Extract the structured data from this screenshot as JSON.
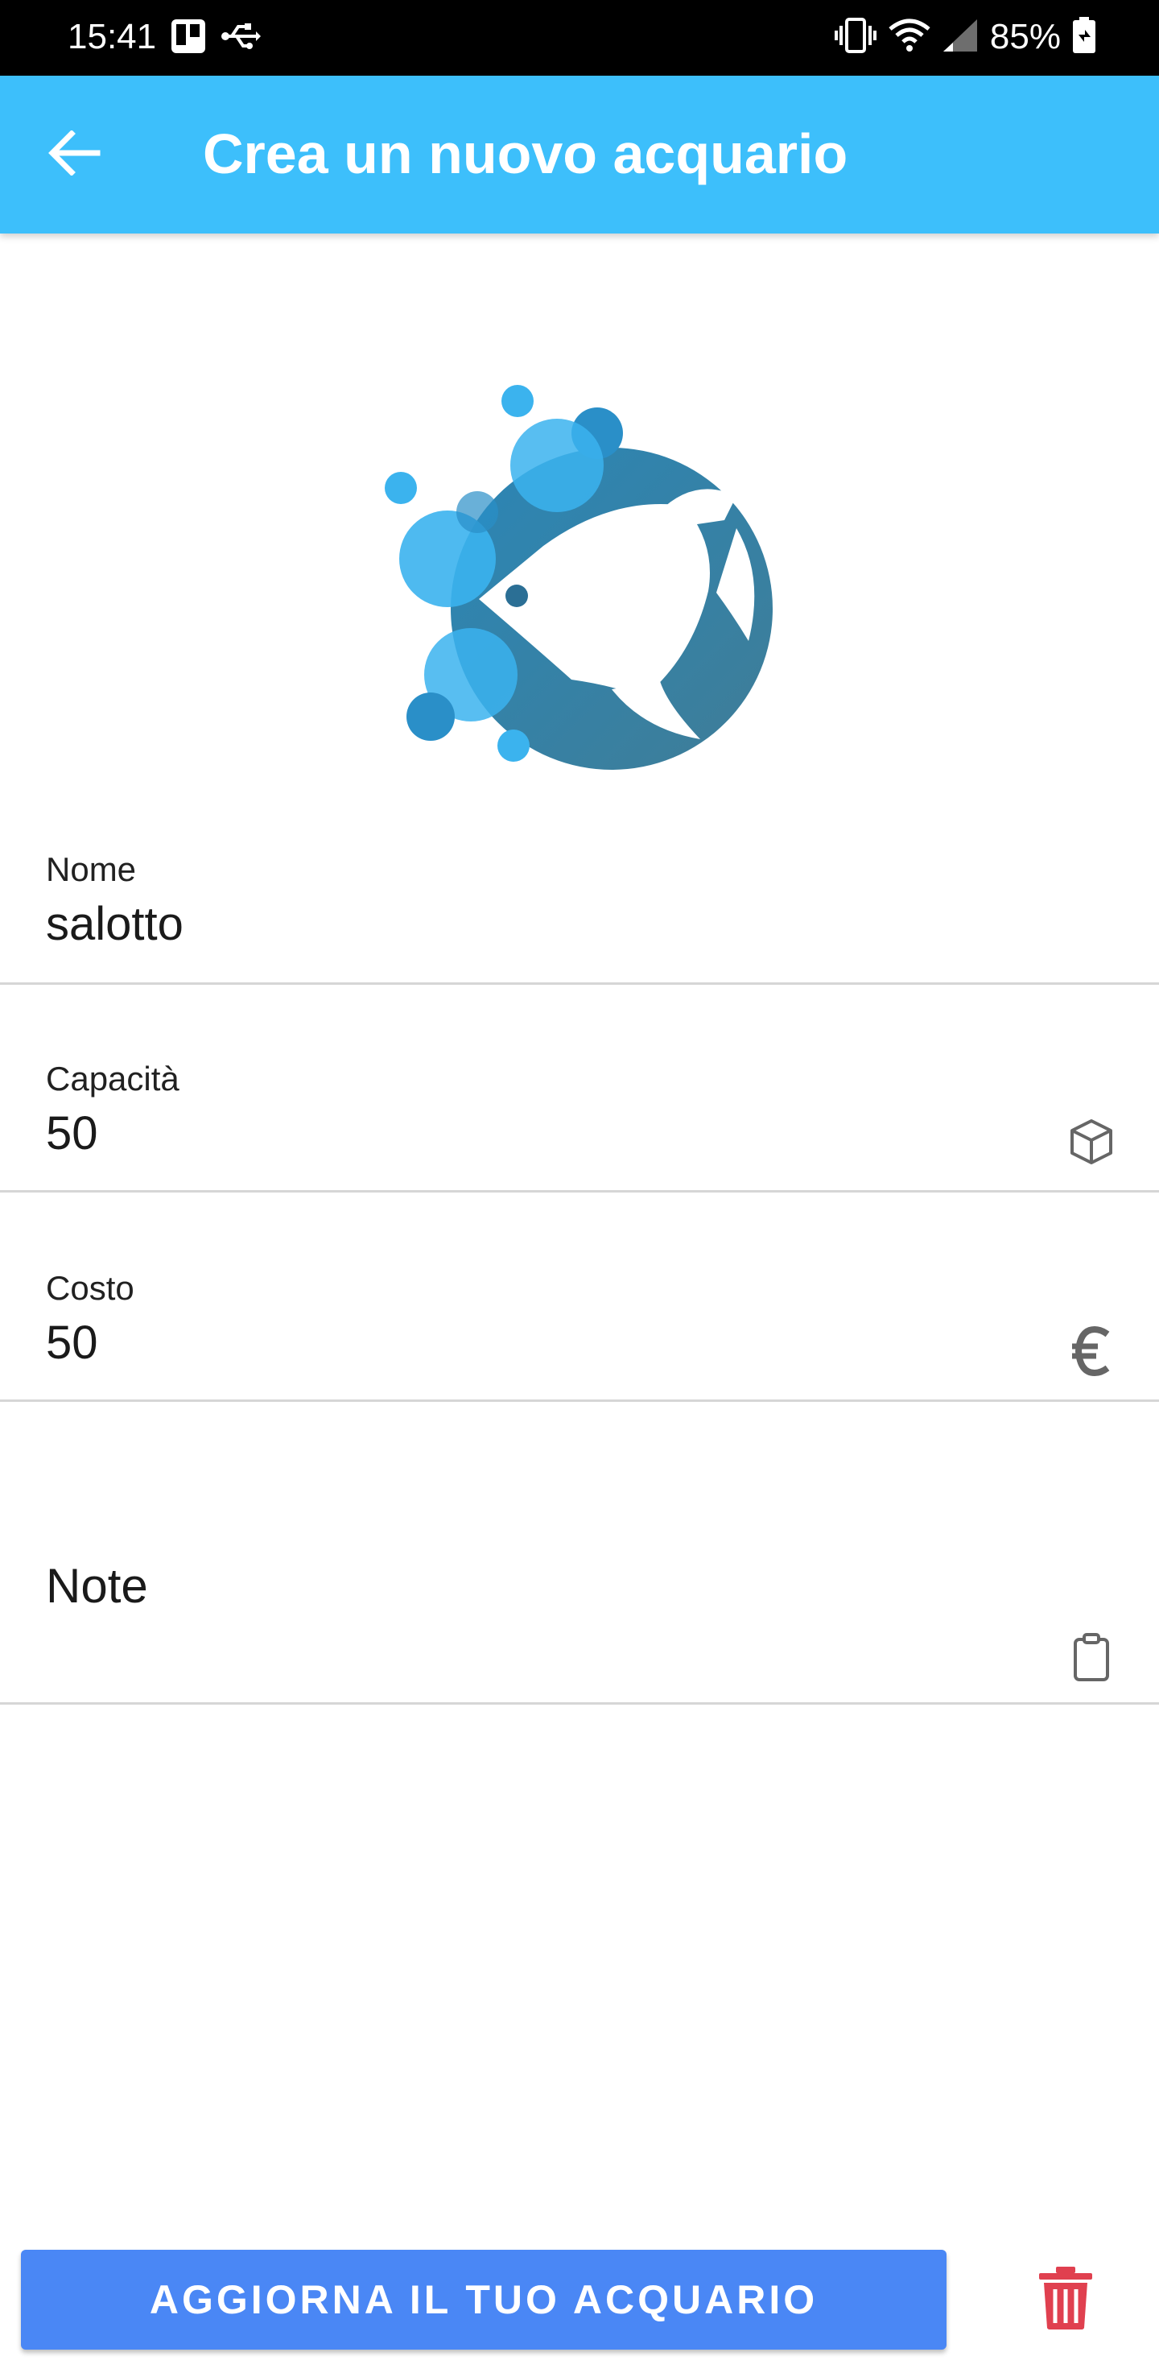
{
  "status_bar": {
    "time": "15:41",
    "battery_text": "85%",
    "left_icons": [
      "trello-icon",
      "usb-icon"
    ],
    "right_icons": [
      "vibrate-icon",
      "wifi-icon",
      "signal-icon",
      "battery-charging-icon"
    ]
  },
  "app_bar": {
    "title": "Crea un nuovo acquario",
    "back_icon": "arrow-left-icon",
    "color": "#3dbffb"
  },
  "form": {
    "nome": {
      "label": "Nome",
      "value": "salotto"
    },
    "capacita": {
      "label": "Capacità",
      "value": "50",
      "icon": "cube-icon"
    },
    "costo": {
      "label": "Costo",
      "value": "50",
      "icon": "euro-icon"
    },
    "note": {
      "label": "Note",
      "value": "",
      "icon": "clipboard-icon"
    }
  },
  "actions": {
    "primary_label": "AGGIORNA IL TUO ACQUARIO",
    "primary_color": "#4a87f5",
    "delete_icon": "trash-icon",
    "delete_color": "#e0404f"
  }
}
